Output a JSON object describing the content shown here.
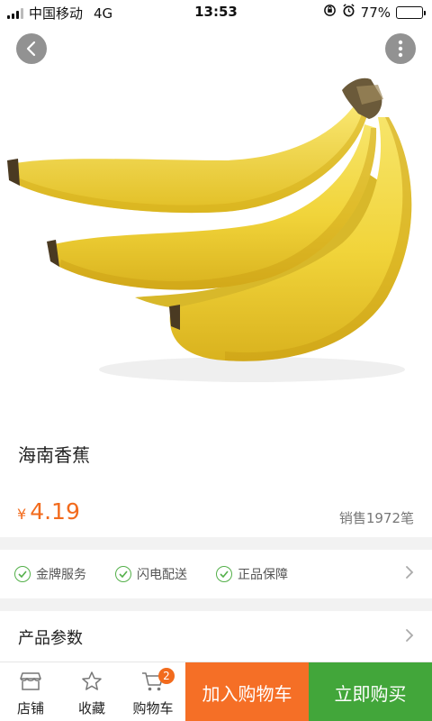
{
  "status_bar": {
    "carrier": "中国移动",
    "network": "4G",
    "time": "13:53",
    "battery": "77%",
    "battery_level": 0.77
  },
  "icons": {
    "back": "chevron-left-icon",
    "more": "more-vertical-icon",
    "store": "store-icon",
    "favorite": "star-icon",
    "cart": "cart-icon",
    "check": "check-circle-icon",
    "chevron": "chevron-right-icon"
  },
  "product": {
    "name": "海南香蕉",
    "currency": "¥",
    "price": "4.19",
    "sales": "销售1972笔"
  },
  "services": {
    "items": [
      "金牌服务",
      "闪电配送",
      "正品保障"
    ]
  },
  "params": {
    "label": "产品参数"
  },
  "bottom_bar": {
    "store": "店铺",
    "favorite": "收藏",
    "cart": "购物车",
    "cart_count": "2",
    "add_to_cart": "加入购物车",
    "buy_now": "立即购买"
  },
  "colors": {
    "accent_orange": "#f56f26",
    "accent_green": "#42a63a",
    "check_green": "#54b04a"
  }
}
